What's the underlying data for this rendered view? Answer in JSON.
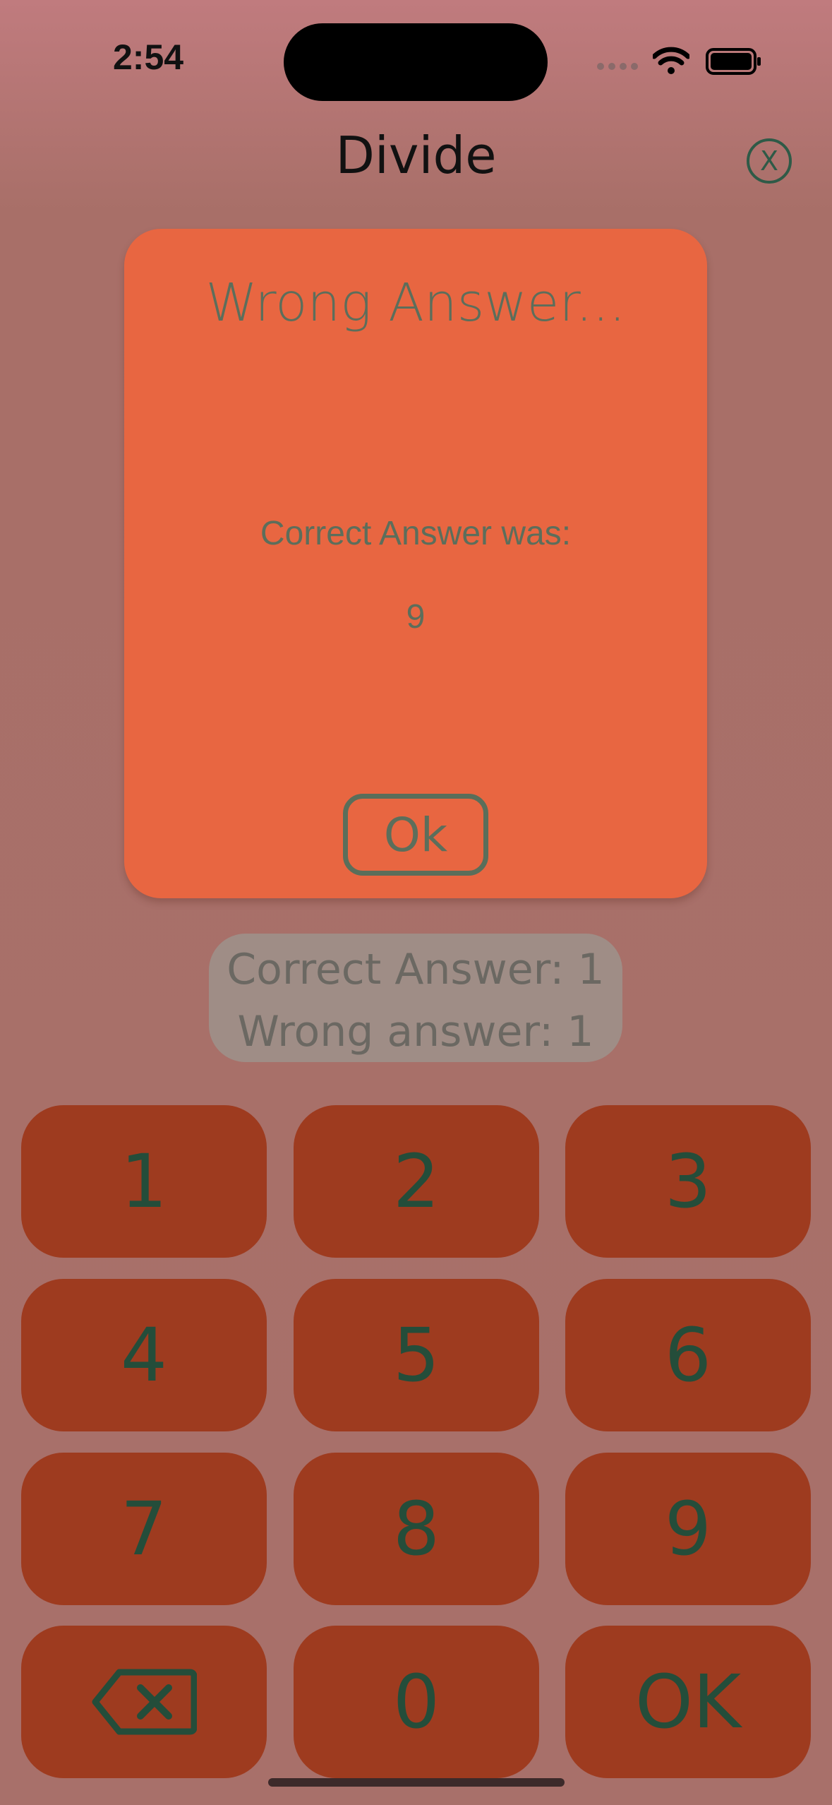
{
  "status_bar": {
    "time": "2:54"
  },
  "header": {
    "title": "Divide",
    "close_label": "X"
  },
  "dialog": {
    "title": "Wrong Answer...",
    "label": "Correct Answer was:",
    "value": "9",
    "ok_label": "Ok"
  },
  "score": {
    "correct": "Correct Answer: 1",
    "wrong": "Wrong answer: 1"
  },
  "keypad": {
    "k1": "1",
    "k2": "2",
    "k3": "3",
    "k4": "4",
    "k5": "5",
    "k6": "6",
    "k7": "7",
    "k8": "8",
    "k9": "9",
    "k0": "0",
    "ok": "OK",
    "backspace_icon": "delete-backspace-icon"
  },
  "colors": {
    "background": "#a8706a",
    "dialog": "#e86641",
    "key": "#9e3b1f",
    "key_text": "#244d3a"
  }
}
